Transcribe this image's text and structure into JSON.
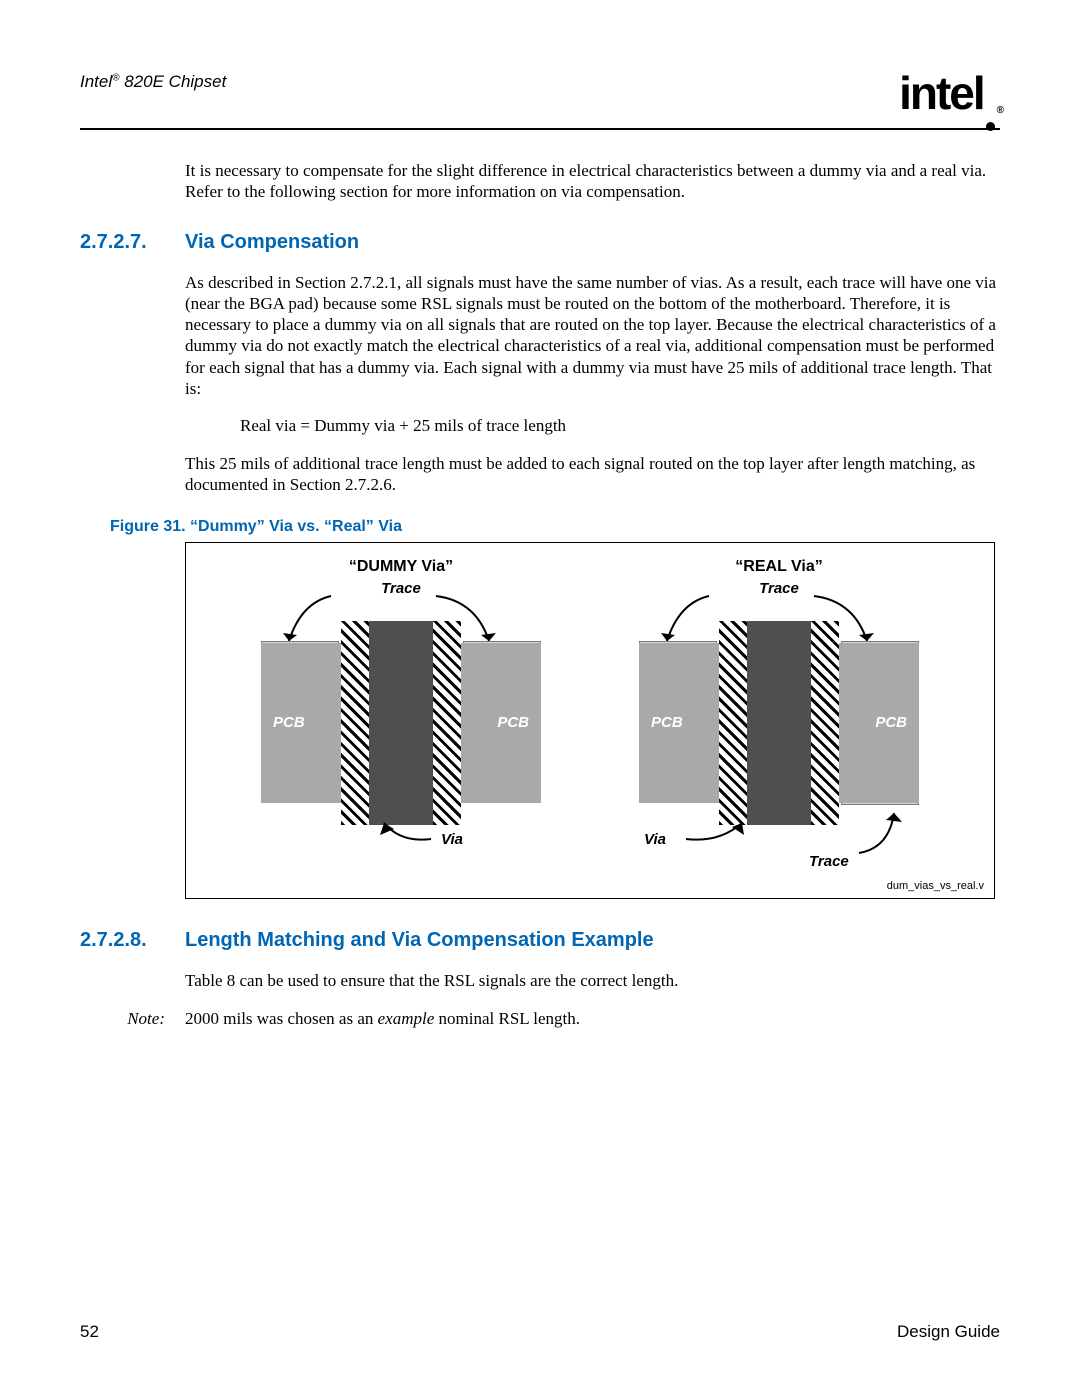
{
  "header": {
    "doc_title_prefix": "Intel",
    "doc_title_suffix": " 820E Chipset",
    "logo_text": "intel"
  },
  "intro_para": "It is necessary to compensate for the slight difference in electrical characteristics between a dummy via and a real via. Refer to the following section for more information on via compensation.",
  "section_27_2_7": {
    "num": "2.7.2.7.",
    "title": "Via Compensation",
    "para1": "As described in Section 2.7.2.1, all signals must have the same number of vias. As a result, each trace will have one via (near the BGA pad) because some RSL signals must be routed on the bottom of the motherboard. Therefore, it is necessary to place a dummy via on all signals that are routed on the top layer. Because the electrical characteristics of a dummy via do not exactly match the electrical characteristics of a real via, additional compensation must be performed for each signal that has a dummy via. Each signal with a dummy via must have 25 mils of additional trace length. That is:",
    "formula": "Real via = Dummy via + 25 mils of trace length",
    "para2": "This 25 mils of additional trace length must be added to each signal routed on the top layer after length matching, as documented in Section 2.7.2.6."
  },
  "figure31": {
    "caption": "Figure 31. “Dummy” Via vs. “Real” Via",
    "dummy_title": "“DUMMY Via”",
    "real_title": "“REAL Via”",
    "trace_label": "Trace",
    "via_label": "Via",
    "pcb_label": "PCB",
    "file_tag": "dum_vias_vs_real.v"
  },
  "section_27_2_8": {
    "num": "2.7.2.8.",
    "title": "Length Matching and Via Compensation Example",
    "para1": "Table 8 can be used to ensure that the RSL signals are the correct length.",
    "note_label": "Note:",
    "note_text_pre": "2000 mils was chosen as an ",
    "note_text_em": "example",
    "note_text_post": " nominal RSL length."
  },
  "footer": {
    "page_num": "52",
    "doc_type": "Design Guide"
  }
}
